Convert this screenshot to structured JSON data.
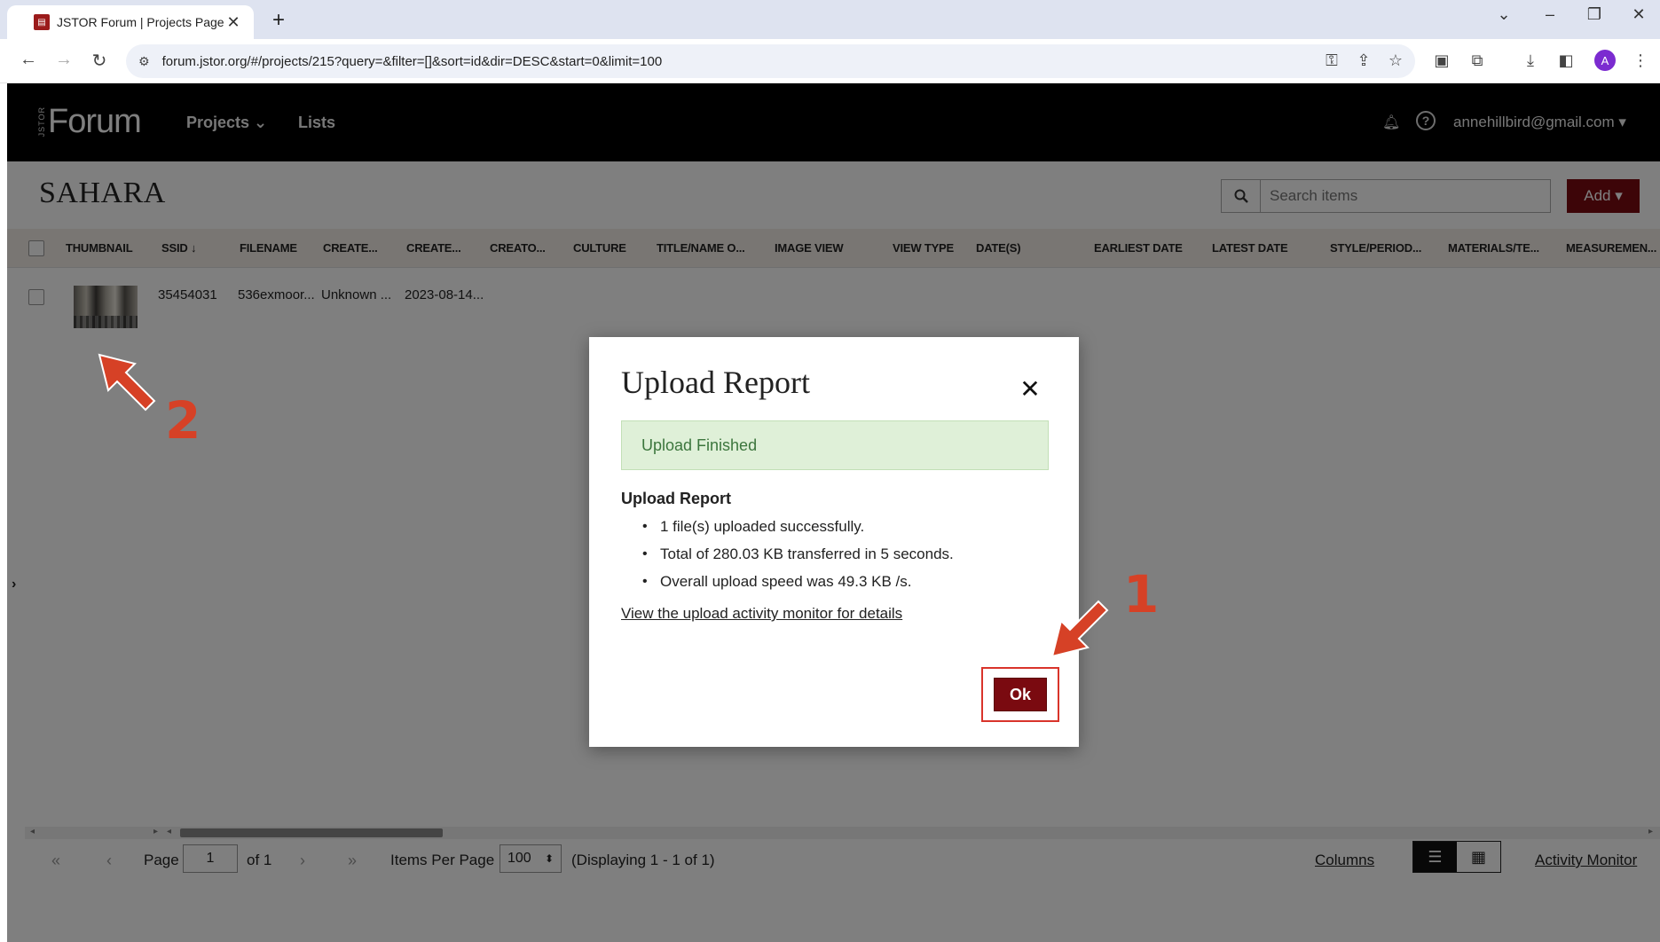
{
  "browser": {
    "tab_title": "JSTOR Forum | Projects Page",
    "tab_close": "✕",
    "new_tab": "+",
    "url": "forum.jstor.org/#/projects/215?query=&filter=[]&sort=id&dir=DESC&start=0&limit=100",
    "profile_initial": "A"
  },
  "app": {
    "logo_small": "JSTOR",
    "logo": "Forum",
    "nav": [
      {
        "label": "Projects ⌄"
      },
      {
        "label": "Lists"
      }
    ],
    "user": "annehillbird@gmail.com ▾",
    "project_title": "SAHARA",
    "search_placeholder": "Search items",
    "add_label": "Add ▾"
  },
  "table": {
    "columns": [
      "THUMBNAIL",
      "SSID ↓",
      "FILENAME",
      "CREATE...",
      "CREATE...",
      "CREATO...",
      "CULTURE",
      "TITLE/NAME O...",
      "IMAGE VIEW",
      "VIEW TYPE",
      "DATE(S)",
      "EARLIEST DATE",
      "LATEST DATE",
      "STYLE/PERIOD...",
      "MATERIALS/TE...",
      "MEASUREMEN..."
    ],
    "rows": [
      {
        "ssid": "35454031",
        "filename": "536exmoor...",
        "creator": "Unknown ...",
        "created": "2023-08-14..."
      }
    ]
  },
  "footer": {
    "page_label": "Page",
    "page_value": "1",
    "page_of": "of 1",
    "items_per_page_label": "Items Per Page",
    "items_per_page_value": "100",
    "displaying": "(Displaying 1 - 1 of 1)",
    "columns_link": "Columns",
    "activity_monitor_link": "Activity Monitor"
  },
  "modal": {
    "title": "Upload Report",
    "alert": "Upload Finished",
    "report_heading": "Upload Report",
    "items": [
      "1 file(s) uploaded successfully.",
      "Total of 280.03 KB transferred in 5 seconds.",
      "Overall upload speed was 49.3 KB /s."
    ],
    "details_link": "View the upload activity monitor for details",
    "ok_label": "Ok"
  },
  "annotations": {
    "marker_1": "1",
    "marker_2": "2",
    "color": "#d64126"
  }
}
